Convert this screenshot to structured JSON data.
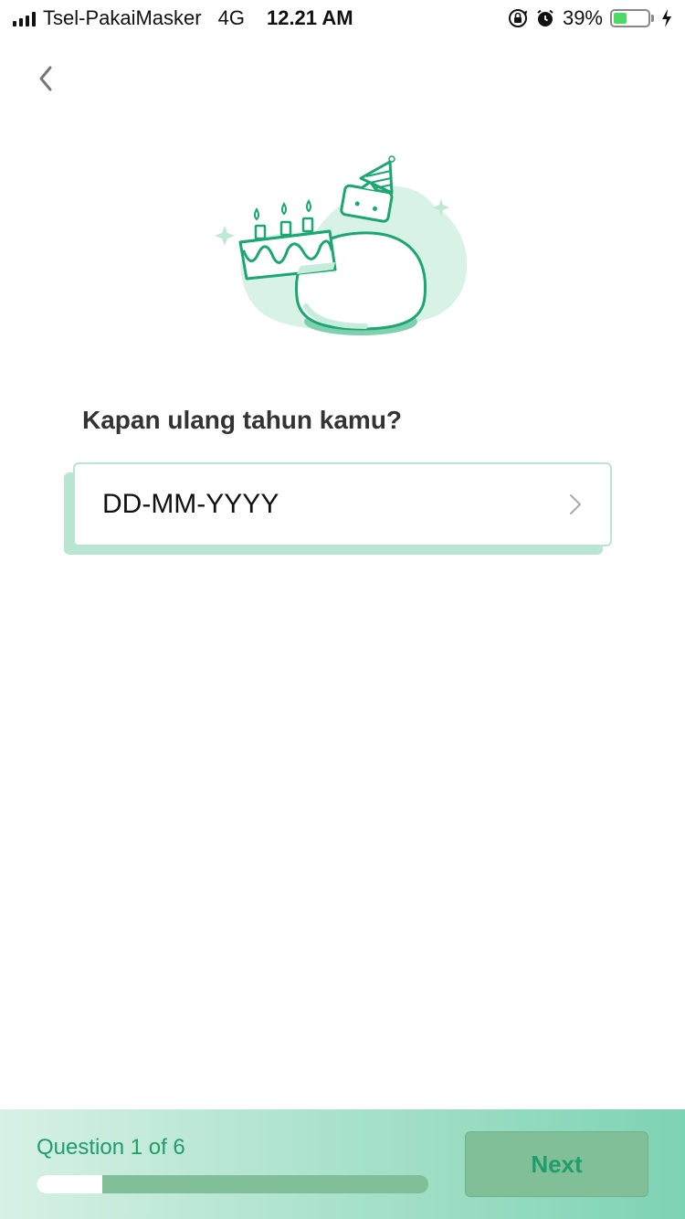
{
  "status_bar": {
    "carrier": "Tsel-PakaiMasker",
    "network": "4G",
    "time": "12.21 AM",
    "battery_percent": "39%",
    "battery_level": 0.39,
    "battery_color": "#4cd964",
    "icons": [
      "signal-icon",
      "orientation-lock-icon",
      "alarm-icon",
      "battery-icon",
      "charging-icon"
    ]
  },
  "nav": {
    "back_icon": "chevron-left-icon"
  },
  "illustration": {
    "name": "birthday-cake-illustration",
    "accent_color": "#1aa772",
    "soft_color": "#d8f2e6"
  },
  "question": {
    "title": "Kapan ulang tahun kamu?",
    "field_placeholder": "DD-MM-YYYY",
    "field_icon": "chevron-right-icon"
  },
  "footer": {
    "progress_label": "Question 1 of 6",
    "progress_value": 0.167,
    "next_label": "Next",
    "accent_color": "#1f9d6b"
  }
}
